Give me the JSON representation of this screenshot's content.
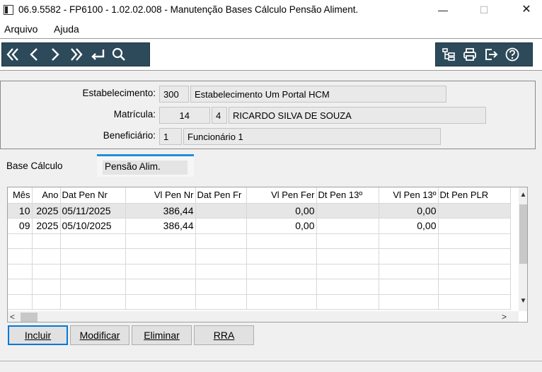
{
  "window": {
    "title": "06.9.5582 - FP6100 - 1.02.02.008 - Manutenção Bases Cálculo Pensão Aliment.",
    "minimize": "—",
    "maximize": "☐",
    "close": "✕"
  },
  "menu": {
    "items": [
      "Arquivo",
      "Ajuda"
    ]
  },
  "toolbar": {
    "nav_icons": [
      "first-icon",
      "prev-icon",
      "next-icon",
      "last-icon",
      "enter-icon",
      "search-icon"
    ],
    "right_icons": [
      "tree-icon",
      "print-icon",
      "exit-icon",
      "help-icon"
    ],
    "bg_color": "#2c4a5a"
  },
  "header": {
    "estabelecimento_label": "Estabelecimento:",
    "estabelecimento_code": "300",
    "estabelecimento_name": "Estabelecimento Um Portal HCM",
    "matricula_label": "Matrícula:",
    "matricula_code": "14",
    "matricula_digit": "4",
    "matricula_name": "RICARDO SILVA DE SOUZA",
    "beneficiario_label": "Beneficiário:",
    "beneficiario_code": "1",
    "beneficiario_name": "Funcionário 1"
  },
  "tabs": {
    "base_calculo": "Base Cálculo",
    "pensao_alim": "Pensão Alim.",
    "active_color": "#1e90d8"
  },
  "grid": {
    "columns": [
      "Mês",
      "Ano",
      "Dat Pen Nr",
      "Vl Pen Nr",
      "Dat Pen Fr",
      "Vl Pen Fer",
      "Dt Pen 13º",
      "Vl Pen 13º",
      "Dt Pen PLR"
    ],
    "rows": [
      [
        "10",
        "2025",
        "05/11/2025",
        "386,44",
        "",
        "0,00",
        "",
        "0,00",
        ""
      ],
      [
        "09",
        "2025",
        "05/10/2025",
        "386,44",
        "",
        "0,00",
        "",
        "0,00",
        ""
      ],
      [
        "",
        "",
        "",
        "",
        "",
        "",
        "",
        "",
        ""
      ],
      [
        "",
        "",
        "",
        "",
        "",
        "",
        "",
        "",
        ""
      ],
      [
        "",
        "",
        "",
        "",
        "",
        "",
        "",
        "",
        ""
      ],
      [
        "",
        "",
        "",
        "",
        "",
        "",
        "",
        "",
        ""
      ],
      [
        "",
        "",
        "",
        "",
        "",
        "",
        "",
        "",
        ""
      ]
    ]
  },
  "buttons": {
    "incluir": "Incluir",
    "modificar": "Modificar",
    "eliminar": "Eliminar",
    "rra": "RRA"
  }
}
